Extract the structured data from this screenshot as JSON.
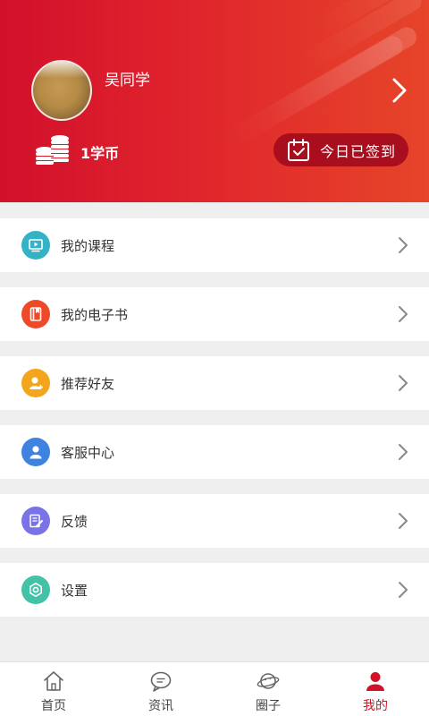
{
  "profile": {
    "username": "吴同学",
    "coins_label": "1学币",
    "checkin_label": "今日已签到"
  },
  "colors": {
    "brand_red": "#d31227",
    "checkin_bg": "#a80e1d",
    "courses_icon": "#34b3c7",
    "ebook_icon": "#ee4a2a",
    "invite_icon": "#f3a51c",
    "service_icon": "#3d83df",
    "feedback_icon": "#7a73e8",
    "settings_icon": "#43c2a7"
  },
  "menu": [
    {
      "label": "我的课程",
      "icon": "video-screen-icon"
    },
    {
      "label": "我的电子书",
      "icon": "book-icon"
    },
    {
      "label": "推荐好友",
      "icon": "add-friend-icon"
    },
    {
      "label": "客服中心",
      "icon": "user-icon"
    },
    {
      "label": "反馈",
      "icon": "edit-note-icon"
    },
    {
      "label": "设置",
      "icon": "gear-icon"
    }
  ],
  "tabbar": {
    "active": "我的",
    "tabs": [
      {
        "label": "首页",
        "icon": "home-icon"
      },
      {
        "label": "资讯",
        "icon": "chat-bubble-icon"
      },
      {
        "label": "圈子",
        "icon": "planet-icon"
      },
      {
        "label": "我的",
        "icon": "person-icon"
      }
    ]
  }
}
